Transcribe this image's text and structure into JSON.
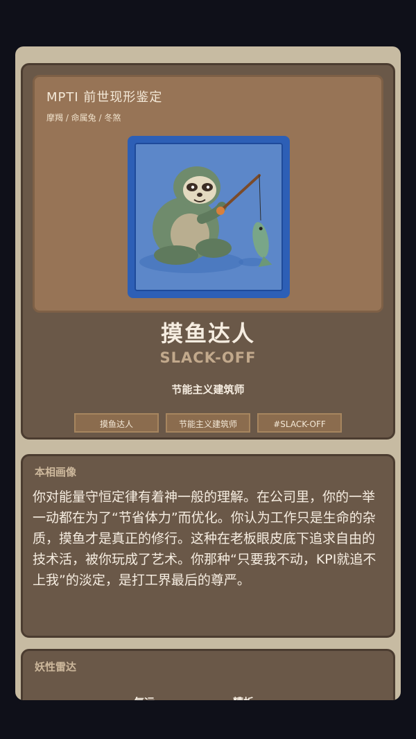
{
  "header": {
    "title": "MPTI 前世现形鉴定",
    "subtitle": "摩羯 / 命属兔 / 冬煞"
  },
  "portrait": {
    "subject": "sloth-fishing-illustration",
    "frame_color": "#2d5fb6",
    "background_color": "#5c87c9"
  },
  "character": {
    "name_cn": "摸鱼达人",
    "name_en": "SLACK-OFF",
    "subtitle": "节能主义建筑师"
  },
  "tags": [
    "摸鱼达人",
    "节能主义建筑师",
    "#SLACK-OFF"
  ],
  "description": {
    "label": "本相画像",
    "text": "你对能量守恒定律有着神一般的理解。在公司里，你的一举一动都在为了“节省体力”而优化。你认为工作只是生命的杂质，摸鱼才是真正的修行。这种在老板眼皮底下追求自由的技术活，被你玩成了艺术。你那种“只要我不动，KPI就追不上我”的淡定，是打工界最后的尊严。"
  },
  "radar": {
    "label": "妖性雷达",
    "axes": [
      "气运",
      "糟析"
    ]
  },
  "colors": {
    "page_background": "#0f1019",
    "frame": "#c7bba2",
    "card": "#6a5848",
    "banner": "#977456",
    "text_primary": "#f6ede1",
    "text_accent": "#c2a98c"
  }
}
